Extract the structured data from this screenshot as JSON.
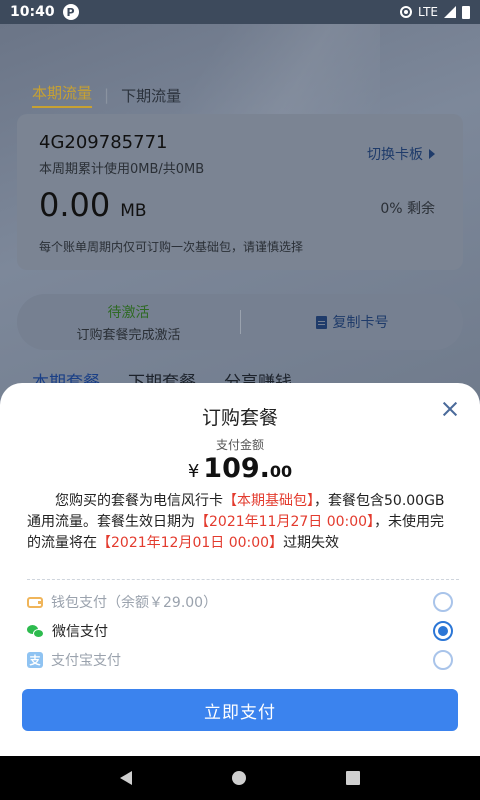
{
  "status_bar": {
    "time": "10:40",
    "badge": "P",
    "network": "LTE"
  },
  "background": {
    "period_tabs": [
      "本期流量",
      "下期流量"
    ],
    "card": {
      "number": "4G209785771",
      "usage": "本周期累计使用0MB/共0MB",
      "switch_label": "切换卡板",
      "amount": "0.00",
      "unit": "MB",
      "remaining": "0% 剩余",
      "tip": "每个账单周期内仅可订购一次基础包，请谨慎选择"
    },
    "actions": {
      "status": "待激活",
      "status_desc": "订购套餐完成激活",
      "copy_label": "复制卡号"
    },
    "package_tabs": [
      "本期套餐",
      "下期套餐",
      "分享赚钱"
    ]
  },
  "sheet": {
    "title": "订购套餐",
    "amount_label": "支付金额",
    "currency": "¥",
    "amount_int": "109.",
    "amount_dec": "00",
    "desc": {
      "p1": "您购买的套餐为电信风行卡",
      "pkg": "【本期基础包】",
      "p2": "，套餐包含50.00GB通用流量。套餐生效日期为",
      "start": "【2021年11月27日 00:00】",
      "p3": "，未使用完的流量将在",
      "end": "【2021年12月01日 00:00】",
      "p4": "过期失效"
    },
    "payment_methods": [
      {
        "label": "钱包支付（余额￥29.00）",
        "icon": "wallet-icon",
        "selected": false,
        "disabled": true
      },
      {
        "label": "微信支付",
        "icon": "wechat-icon",
        "selected": true,
        "disabled": false
      },
      {
        "label": "支付宝支付",
        "icon": "alipay-icon",
        "selected": false,
        "disabled": true
      }
    ],
    "alipay_glyph": "支",
    "pay_button": "立即支付"
  },
  "colors": {
    "primary": "#3b83ee",
    "highlight": "#e33b2e",
    "wechat": "#2dbb4e"
  }
}
